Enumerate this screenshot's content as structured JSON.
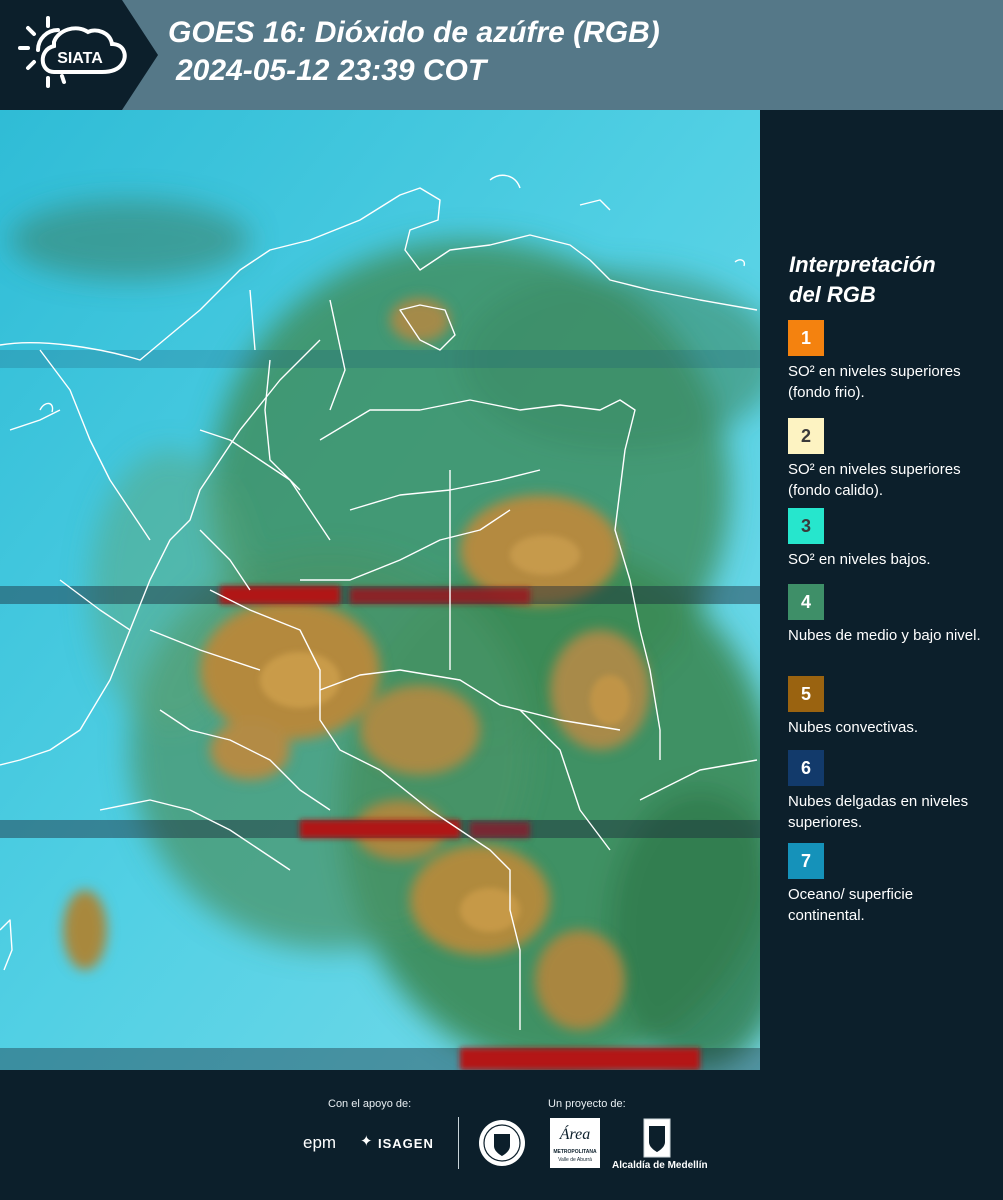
{
  "header": {
    "logo_text": "SIATA",
    "title_line1": "GOES 16: Dióxido de azúfre (RGB)",
    "title_line2": "2024-05-12 23:39 COT"
  },
  "legend": {
    "title_line1": "Interpretación",
    "title_line2": "del RGB",
    "items": [
      {
        "number": "1",
        "color": "#f4820f",
        "text": "SO² en niveles superiores (fondo frio)."
      },
      {
        "number": "2",
        "color": "#fdf3c2",
        "text": "SO² en niveles superiores (fondo calido)."
      },
      {
        "number": "3",
        "color": "#26e6cd",
        "text": "SO² en niveles bajos."
      },
      {
        "number": "4",
        "color": "#3e8f68",
        "text": "Nubes de medio y bajo nivel."
      },
      {
        "number": "5",
        "color": "#9a6310",
        "text": "Nubes convectivas."
      },
      {
        "number": "6",
        "color": "#123a6b",
        "text": "Nubes delgadas en niveles superiores."
      },
      {
        "number": "7",
        "color": "#1592ba",
        "text": "Oceano/ superficie continental."
      }
    ]
  },
  "footer": {
    "support_label": "Con el apoyo de:",
    "project_label": "Un proyecto de:",
    "sponsor_epm": "epm",
    "sponsor_isagen": "ISAGEN",
    "partner_area_line1": "Área",
    "partner_area_line2": "METROPOLITANA",
    "partner_area_line3": "Valle de Aburrá",
    "partner_alcaldia": "Alcaldía de Medellín"
  },
  "colors": {
    "background": "#0c1f2b",
    "header_bar": "#557888",
    "ocean_cyan": "#3fc6de",
    "convective_brown": "#b08a3c",
    "mid_cloud_green": "#3e8a5a",
    "upper_so2_red": "#b01818",
    "borders": "#ffffff"
  }
}
